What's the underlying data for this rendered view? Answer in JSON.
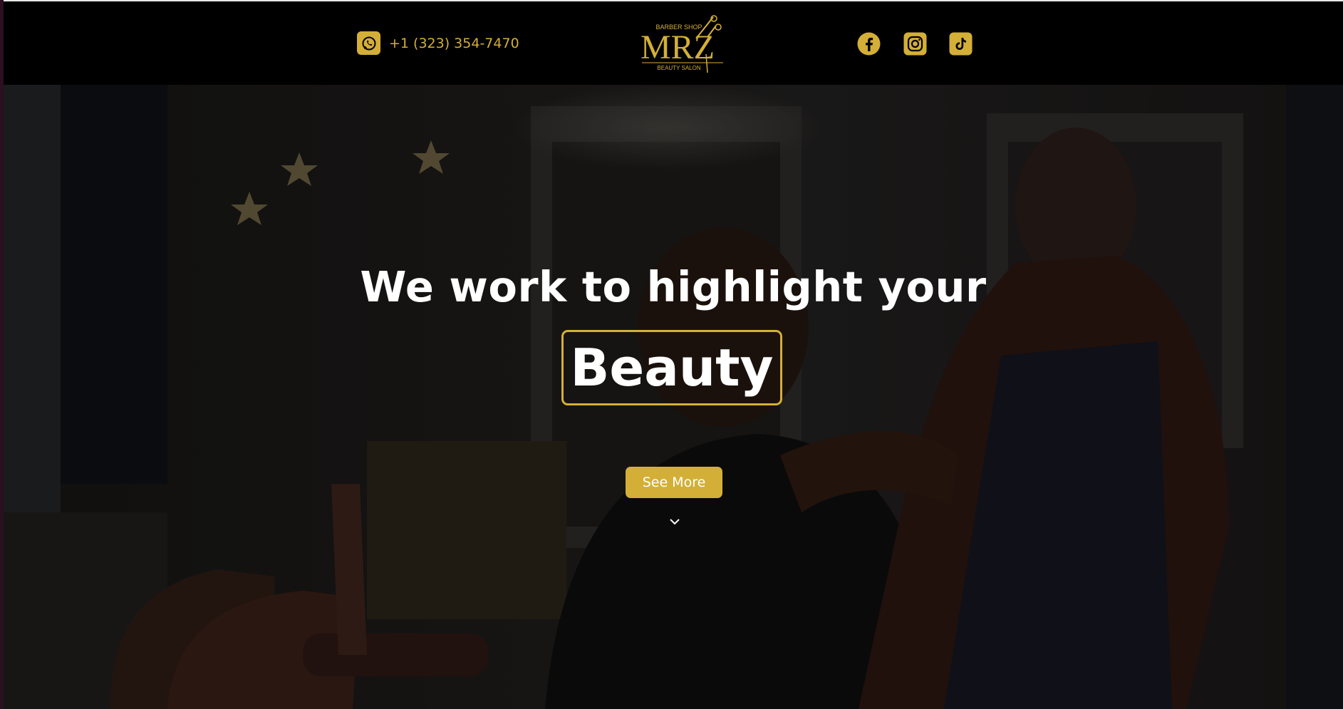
{
  "header": {
    "phone": "+1 (323) 354-7470",
    "logo": {
      "small_top": "BARBER SHOP",
      "main": "MRZ",
      "small_bottom": "BEAUTY SALON"
    },
    "social_icons": [
      "facebook-icon",
      "instagram-icon",
      "tiktok-icon"
    ]
  },
  "hero": {
    "title": "We work to highlight your",
    "highlight": "Beauty",
    "button_label": "See More",
    "scroll_icon": "chevron-down-icon"
  },
  "colors": {
    "accent": "#d4af37",
    "header_bg": "#000000",
    "text": "#ffffff"
  }
}
